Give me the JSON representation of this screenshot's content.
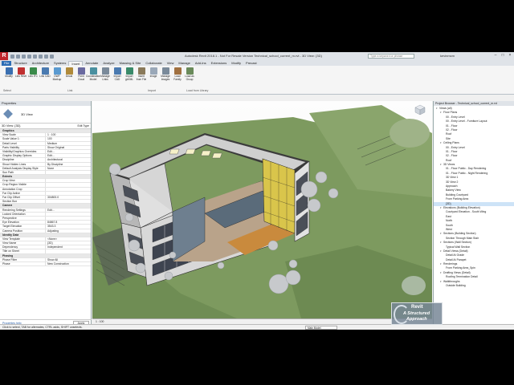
{
  "window": {
    "title": "Autodesk Revit 2018.1 - Not For Resale Version    Technical_school_current_m.rvt - 3D View: {3D}",
    "search_placeholder": "Type a keyword or phrase",
    "user": "kevinmcm"
  },
  "ribbon": {
    "tabs": [
      "File",
      "Structure",
      "Architecture",
      "Systems",
      "Insert",
      "Annotate",
      "Analyze",
      "Massing & Site",
      "Collaborate",
      "View",
      "Manage",
      "Add-Ins",
      "Extensions",
      "Modify",
      "Precast"
    ],
    "active_tab": "Insert",
    "tools": [
      {
        "label": "Modify",
        "color": "#3a6fb0"
      },
      {
        "label": "Link Revit",
        "color": "#c03030"
      },
      {
        "label": "Link IFC",
        "color": "#3a8a4a"
      },
      {
        "label": "Link CAD",
        "color": "#4a7ab0"
      },
      {
        "label": "DWF Markup",
        "color": "#5a9ad0"
      },
      {
        "label": "Decal",
        "color": "#b08a3a"
      },
      {
        "label": "Point Cloud",
        "color": "#6a6aa0"
      },
      {
        "label": "Coordination Model",
        "color": "#4a90a0"
      },
      {
        "label": "Manage Links",
        "color": "#7a8a9a"
      },
      {
        "label": "Import CAD",
        "color": "#4a7ab0"
      },
      {
        "label": "Import gbXML",
        "color": "#3a8a6a"
      },
      {
        "label": "Insert from File",
        "color": "#8a7a5a"
      },
      {
        "label": "Image",
        "color": "#9aa8b8"
      },
      {
        "label": "Manage Images",
        "color": "#7a8a9a"
      },
      {
        "label": "Load Family",
        "color": "#a07040"
      },
      {
        "label": "Load as Group",
        "color": "#6a8a5a"
      }
    ],
    "panels": [
      "Select",
      "Link",
      "Import",
      "Load from Library"
    ]
  },
  "properties": {
    "header": "Properties",
    "type_name": "3D View",
    "view_selector": "3D View: {3D}",
    "edit_type": "Edit Type",
    "rows": [
      {
        "k": "Graphics",
        "v": "",
        "group": true
      },
      {
        "k": "View Scale",
        "v": "1 : 100"
      },
      {
        "k": "Scale Value    1:",
        "v": "100"
      },
      {
        "k": "Detail Level",
        "v": "Medium"
      },
      {
        "k": "Parts Visibility",
        "v": "Show Original"
      },
      {
        "k": "Visibility/Graphics Overrides",
        "v": "Edit..."
      },
      {
        "k": "Graphic Display Options",
        "v": "Edit..."
      },
      {
        "k": "Discipline",
        "v": "Architectural"
      },
      {
        "k": "Show Hidden Lines",
        "v": "By Discipline"
      },
      {
        "k": "Default Analysis Display Style",
        "v": "None"
      },
      {
        "k": "Sun Path",
        "v": ""
      },
      {
        "k": "Extents",
        "v": "",
        "group": true
      },
      {
        "k": "Crop View",
        "v": ""
      },
      {
        "k": "Crop Region Visible",
        "v": ""
      },
      {
        "k": "Annotation Crop",
        "v": ""
      },
      {
        "k": "Far Clip Active",
        "v": ""
      },
      {
        "k": "Far Clip Offset",
        "v": "304800.0"
      },
      {
        "k": "Section Box",
        "v": ""
      },
      {
        "k": "Camera",
        "v": "",
        "group": true
      },
      {
        "k": "Rendering Settings",
        "v": "Edit..."
      },
      {
        "k": "Locked Orientation",
        "v": ""
      },
      {
        "k": "Perspective",
        "v": ""
      },
      {
        "k": "Eye Elevation",
        "v": "84867.8"
      },
      {
        "k": "Target Elevation",
        "v": "3543.3"
      },
      {
        "k": "Camera Position",
        "v": "Adjusting"
      },
      {
        "k": "Identity Data",
        "v": "",
        "group": true
      },
      {
        "k": "View Template",
        "v": "<None>"
      },
      {
        "k": "View Name",
        "v": "{3D}"
      },
      {
        "k": "Dependency",
        "v": "Independent"
      },
      {
        "k": "Title on Sheet",
        "v": ""
      },
      {
        "k": "Phasing",
        "v": "",
        "group": true
      },
      {
        "k": "Phase Filter",
        "v": "Show All"
      },
      {
        "k": "Phase",
        "v": "New Construction"
      }
    ],
    "help_link": "Properties help",
    "apply": "Apply"
  },
  "browser": {
    "header": "Project Browser - Technical_school_current_m.rvt",
    "nodes": [
      {
        "t": "Views (all)",
        "l": 0,
        "tw": "-"
      },
      {
        "t": "Floor Plans",
        "l": 1,
        "tw": "-"
      },
      {
        "t": "00 - Entry Level",
        "l": 2
      },
      {
        "t": "00 - Entry Level - Furniture Layout",
        "l": 2
      },
      {
        "t": "01 - Floor",
        "l": 2
      },
      {
        "t": "02 - Floor",
        "l": 2
      },
      {
        "t": "Roof",
        "l": 2
      },
      {
        "t": "Site",
        "l": 2
      },
      {
        "t": "Ceiling Plans",
        "l": 1,
        "tw": "-"
      },
      {
        "t": "00 - Entry Level",
        "l": 2
      },
      {
        "t": "01 - Floor",
        "l": 2
      },
      {
        "t": "02 - Floor",
        "l": 2
      },
      {
        "t": "Roof",
        "l": 2
      },
      {
        "t": "3D Views",
        "l": 1,
        "tw": "-"
      },
      {
        "t": "01 - Floor Public - Day Rendering",
        "l": 2
      },
      {
        "t": "01 - Floor Public - Night Rendering",
        "l": 2
      },
      {
        "t": "3D View 1",
        "l": 2
      },
      {
        "t": "3D View 2",
        "l": 2
      },
      {
        "t": "Approach",
        "l": 2
      },
      {
        "t": "Bakery View",
        "l": 2
      },
      {
        "t": "Building Courtyard",
        "l": 2
      },
      {
        "t": "From Parking Area",
        "l": 2
      },
      {
        "t": "{3D}",
        "l": 2,
        "sel": true
      },
      {
        "t": "Elevations (Building Elevation)",
        "l": 1,
        "tw": "-"
      },
      {
        "t": "Courtyard Elevation - South Wing",
        "l": 2
      },
      {
        "t": "East",
        "l": 2
      },
      {
        "t": "North",
        "l": 2
      },
      {
        "t": "South",
        "l": 2
      },
      {
        "t": "West",
        "l": 2
      },
      {
        "t": "Sections (Building Section)",
        "l": 1,
        "tw": "-"
      },
      {
        "t": "Section Through Main Stair",
        "l": 2
      },
      {
        "t": "Sections (Wall Section)",
        "l": 1,
        "tw": "-"
      },
      {
        "t": "Typical Wall Section",
        "l": 2
      },
      {
        "t": "Detail Views (Detail)",
        "l": 1,
        "tw": "-"
      },
      {
        "t": "Detail At Grade",
        "l": 2
      },
      {
        "t": "Detail At Parapet",
        "l": 2
      },
      {
        "t": "Renderings",
        "l": 1,
        "tw": "-"
      },
      {
        "t": "From Parking Area_Spin",
        "l": 2
      },
      {
        "t": "Drafting Views (Detail)",
        "l": 1,
        "tw": "-"
      },
      {
        "t": "Roofing Termination Detail",
        "l": 2
      },
      {
        "t": "Walkthroughs",
        "l": 1,
        "tw": "-"
      },
      {
        "t": "Outside Building",
        "l": 2
      }
    ]
  },
  "viewbar": {
    "scale": "1 : 100"
  },
  "status": {
    "message": "Click to select, TAB for alternates, CTRL adds, SHIFT unselects.",
    "model": "Main Model"
  },
  "watermark": {
    "line1": "Revit",
    "line2": "A Structured",
    "line3": "Approach"
  }
}
